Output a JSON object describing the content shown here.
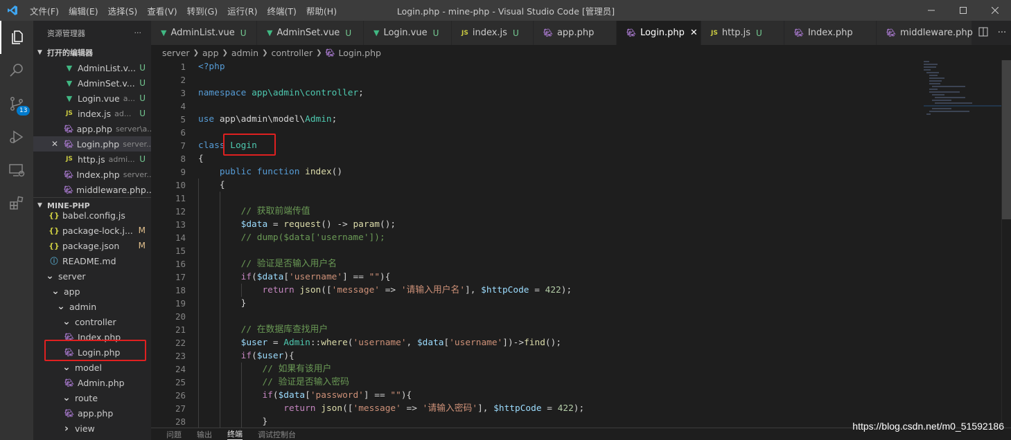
{
  "titlebar": {
    "menu": [
      "文件(F)",
      "编辑(E)",
      "选择(S)",
      "查看(V)",
      "转到(G)",
      "运行(R)",
      "终端(T)",
      "帮助(H)"
    ],
    "title": "Login.php - mine-php - Visual Studio Code [管理员]",
    "accent": "#007acc"
  },
  "activitybar": {
    "items": [
      "files-icon",
      "search-icon",
      "source-control-icon",
      "run-debug-icon",
      "remote-explorer-icon",
      "extensions-icon"
    ],
    "scm_badge": "13"
  },
  "sidebar": {
    "header": "资源管理器",
    "more": "···",
    "open_editors_title": "打开的编辑器",
    "open_editors": [
      {
        "icon": "vue",
        "name": "AdminList.v...",
        "desc": "",
        "status": "U"
      },
      {
        "icon": "vue",
        "name": "AdminSet.v...",
        "desc": "",
        "status": "U"
      },
      {
        "icon": "vue",
        "name": "Login.vue",
        "desc": "a...",
        "status": "U"
      },
      {
        "icon": "js",
        "name": "index.js",
        "desc": "ad...",
        "status": "U"
      },
      {
        "icon": "php",
        "name": "app.php",
        "desc": "server\\a...",
        "status": ""
      },
      {
        "icon": "php",
        "name": "Login.php",
        "desc": "server...",
        "status": ""
      },
      {
        "icon": "js",
        "name": "http.js",
        "desc": "admi...",
        "status": "U"
      },
      {
        "icon": "php",
        "name": "Index.php",
        "desc": "server...",
        "status": ""
      },
      {
        "icon": "php",
        "name": "middleware.php...",
        "desc": "",
        "status": ""
      }
    ],
    "project_title": "MINE-PHP",
    "tree": [
      {
        "icon": "json",
        "name": "babel.config.js",
        "status": ""
      },
      {
        "icon": "json",
        "name": "package-lock.j...",
        "status": "M"
      },
      {
        "icon": "json",
        "name": "package.json",
        "status": "M"
      },
      {
        "icon": "info",
        "name": "README.md",
        "status": ""
      },
      {
        "icon": "folder",
        "name": "server",
        "status": ""
      },
      {
        "icon": "folder",
        "name": "app",
        "status": ""
      },
      {
        "icon": "folder",
        "name": "admin",
        "status": ""
      },
      {
        "icon": "folder",
        "name": "controller",
        "status": ""
      },
      {
        "icon": "php",
        "name": "Index.php",
        "status": ""
      },
      {
        "icon": "php",
        "name": "Login.php",
        "status": ""
      },
      {
        "icon": "folder",
        "name": "model",
        "status": ""
      },
      {
        "icon": "php",
        "name": "Admin.php",
        "status": ""
      },
      {
        "icon": "folder",
        "name": "route",
        "status": ""
      },
      {
        "icon": "php",
        "name": "app.php",
        "status": ""
      },
      {
        "icon": "folder-closed",
        "name": "view",
        "status": ""
      }
    ]
  },
  "tabs": [
    {
      "icon": "vue",
      "label": "AdminList.vue",
      "status": "U"
    },
    {
      "icon": "vue",
      "label": "AdminSet.vue",
      "status": "U"
    },
    {
      "icon": "vue",
      "label": "Login.vue",
      "status": "U"
    },
    {
      "icon": "js",
      "label": "index.js",
      "status": "U"
    },
    {
      "icon": "php",
      "label": "app.php",
      "status": ""
    },
    {
      "icon": "php",
      "label": "Login.php",
      "status": ""
    },
    {
      "icon": "js",
      "label": "http.js",
      "status": "U"
    },
    {
      "icon": "php",
      "label": "Index.php",
      "status": ""
    },
    {
      "icon": "php",
      "label": "middleware.php",
      "status": ""
    }
  ],
  "breadcrumb": [
    "server",
    "app",
    "admin",
    "controller",
    "Login.php"
  ],
  "editor": {
    "line_numbers": [
      "1",
      "2",
      "3",
      "4",
      "5",
      "6",
      "7",
      "8",
      "9",
      "10",
      "11",
      "12",
      "13",
      "14",
      "15",
      "16",
      "17",
      "18",
      "19",
      "20",
      "21",
      "22",
      "23",
      "24",
      "25",
      "26",
      "27",
      "28"
    ]
  },
  "panel": {
    "tabs": [
      "问题",
      "输出",
      "终端",
      "调试控制台"
    ]
  },
  "watermark": "https://blog.csdn.net/m0_51592186"
}
